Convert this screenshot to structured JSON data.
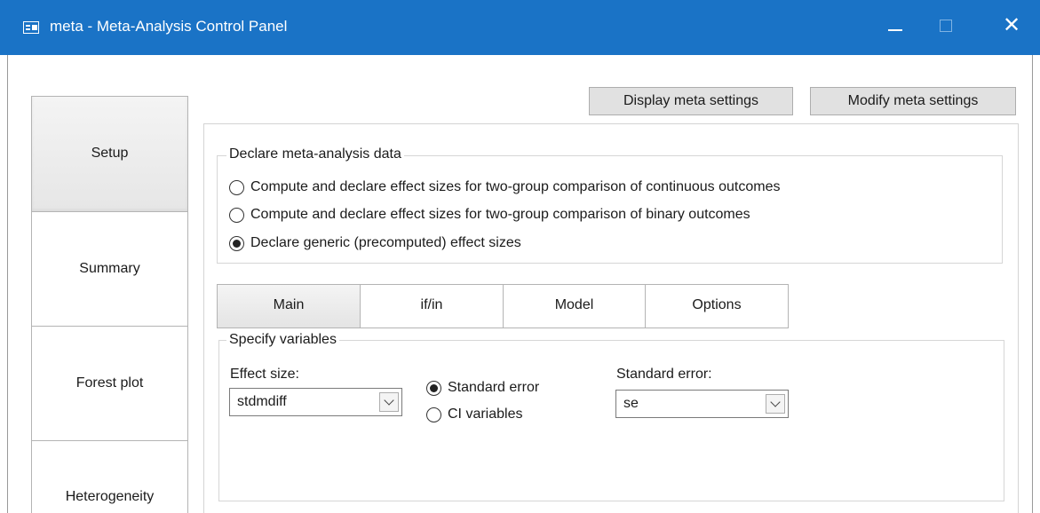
{
  "window": {
    "title": "meta - Meta-Analysis Control Panel",
    "minimize_icon": "minimize-icon",
    "maximize_icon": "maximize-icon",
    "close_glyph": "✕",
    "accent_color": "#1a73c6"
  },
  "nav": {
    "items": [
      {
        "label": "Setup",
        "active": true
      },
      {
        "label": "Summary",
        "active": false
      },
      {
        "label": "Forest plot",
        "active": false
      },
      {
        "label": "Heterogeneity",
        "active": false
      }
    ]
  },
  "toolbar": {
    "display_label": "Display meta settings",
    "modify_label": "Modify meta settings"
  },
  "declare": {
    "legend": "Declare meta-analysis data",
    "options": [
      {
        "label": "Compute and declare effect sizes for two-group comparison of continuous outcomes",
        "checked": false
      },
      {
        "label": "Compute and declare effect sizes for two-group comparison of binary outcomes",
        "checked": false
      },
      {
        "label": "Declare generic (precomputed) effect sizes",
        "checked": true
      }
    ]
  },
  "tabs": [
    {
      "label": "Main",
      "active": true
    },
    {
      "label": "if/in",
      "active": false
    },
    {
      "label": "Model",
      "active": false
    },
    {
      "label": "Options",
      "active": false
    }
  ],
  "specify": {
    "legend": "Specify variables",
    "effect_size_label": "Effect size:",
    "effect_size_value": "stdmdiff",
    "se_options": [
      {
        "label": "Standard error",
        "checked": true
      },
      {
        "label": "CI variables",
        "checked": false
      }
    ],
    "standard_error_label": "Standard error:",
    "standard_error_value": "se"
  }
}
